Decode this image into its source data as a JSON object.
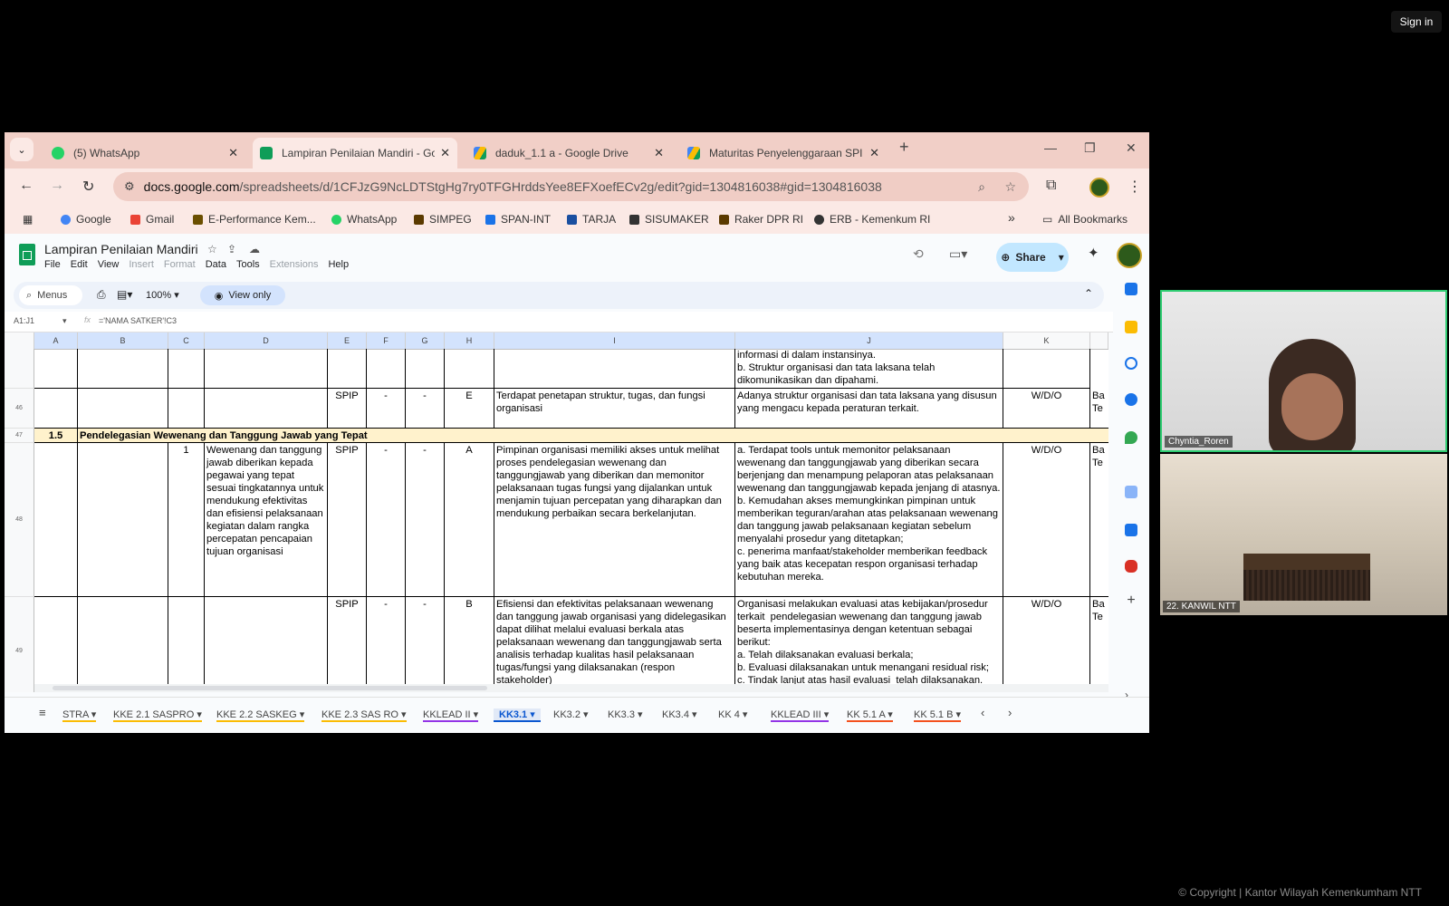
{
  "screen": {
    "signin_label": "Sign in",
    "copyright": "© Copyright | Kantor Wilayah Kemenkumham NTT"
  },
  "browser": {
    "tabs": [
      {
        "label": "(5) WhatsApp",
        "icon": "whatsapp-icon",
        "color": "#25d366"
      },
      {
        "label": "Lampiran Penilaian Mandiri - Go",
        "icon": "sheets-icon",
        "color": "#0f9d58"
      },
      {
        "label": "daduk_1.1 a - Google Drive",
        "icon": "drive-icon",
        "color": "#fbbc04"
      },
      {
        "label": "Maturitas Penyelenggaraan SPI",
        "icon": "drive-icon",
        "color": "#fbbc04"
      }
    ],
    "url_host": "docs.google.com",
    "url_path": "/spreadsheets/d/1CFJzG9NcLDTStgHg7ry0TFGHrddsYee8EFXoefECv2g/edit?gid=1304816038#gid=1304816038",
    "bookmarks": [
      {
        "label": "Google",
        "color": "#4285f4"
      },
      {
        "label": "Gmail",
        "color": "#ea4335"
      },
      {
        "label": "E-Performance Kem...",
        "color": "#6b4f00"
      },
      {
        "label": "WhatsApp",
        "color": "#25d366"
      },
      {
        "label": "SIMPEG",
        "color": "#5b3a00"
      },
      {
        "label": "SPAN-INT",
        "color": "#1a73e8"
      },
      {
        "label": "TARJA",
        "color": "#1a4fa0"
      },
      {
        "label": "SISUMAKER",
        "color": "#333333"
      },
      {
        "label": "Raker DPR RI",
        "color": "#5b3a00"
      },
      {
        "label": "ERB - Kemenkum RI",
        "color": "#333333"
      }
    ],
    "all_bookmarks": "All Bookmarks",
    "overflow": "»"
  },
  "sheets": {
    "doc_title": "Lampiran Penilaian Mandiri",
    "menus": [
      {
        "label": "File",
        "dim": false
      },
      {
        "label": "Edit",
        "dim": false
      },
      {
        "label": "View",
        "dim": false
      },
      {
        "label": "Insert",
        "dim": true
      },
      {
        "label": "Format",
        "dim": true
      },
      {
        "label": "Data",
        "dim": false
      },
      {
        "label": "Tools",
        "dim": false
      },
      {
        "label": "Extensions",
        "dim": true
      },
      {
        "label": "Help",
        "dim": false
      }
    ],
    "share_label": "Share",
    "menus_search": "Menus",
    "zoom": "100%",
    "view_only": "View only",
    "name_box": "A1:J1",
    "formula": "='NAMA SATKER'!C3",
    "columns": [
      "A",
      "B",
      "C",
      "D",
      "E",
      "F",
      "G",
      "H",
      "I",
      "J",
      "K"
    ],
    "row_numbers": [
      "46",
      "47",
      "48",
      "49"
    ],
    "top_partial": {
      "j": "informasi di dalam instansinya.\nb. Struktur organisasi dan tata laksana telah dikomunikasikan dan dipahami."
    },
    "row46": {
      "e": "SPIP",
      "f": "-",
      "g": "-",
      "h": "E",
      "i": "Terdapat penetapan struktur, tugas, dan fungsi organisasi",
      "j": "Adanya struktur organisasi dan tata laksana yang disusun yang mengacu kepada peraturan terkait.",
      "k": "W/D/O",
      "l": "Ba\nTe"
    },
    "row47": {
      "a": "1.5",
      "b": "Pendelegasian Wewenang dan Tanggung Jawab yang Tepat"
    },
    "row48": {
      "c": "1",
      "d": "Wewenang dan tanggung jawab diberikan kepada pegawai yang tepat sesuai tingkatannya untuk mendukung efektivitas dan efisiensi pelaksanaan kegiatan dalam rangka percepatan pencapaian tujuan organisasi",
      "e": "SPIP",
      "f": "-",
      "g": "-",
      "h": "A",
      "i": "Pimpinan organisasi memiliki akses untuk melihat proses pendelegasian wewenang dan tanggungjawab yang diberikan dan memonitor pelaksanaan tugas fungsi yang dijalankan untuk menjamin tujuan percepatan yang diharapkan dan mendukung perbaikan secara berkelanjutan.",
      "j": "a. Terdapat tools untuk memonitor pelaksanaan wewenang dan tanggungjawab yang diberikan secara berjenjang dan menampung pelaporan atas pelaksanaan wewenang dan tanggungjawab kepada jenjang di atasnya.\nb. Kemudahan akses memungkinkan pimpinan untuk memberikan teguran/arahan atas pelaksanaan wewenang dan tanggung jawab pelaksanaan kegiatan sebelum menyalahi prosedur yang ditetapkan;\nc. penerima manfaat/stakeholder memberikan feedback yang baik atas kecepatan respon organisasi terhadap kebutuhan mereka.",
      "k": "W/D/O",
      "l": "Ba\nTe"
    },
    "row49": {
      "e": "SPIP",
      "f": "-",
      "g": "-",
      "h": "B",
      "i": "Efisiensi dan efektivitas pelaksanaan wewenang dan tanggung jawab organisasi yang didelegasikan dapat dilihat melalui evaluasi berkala atas pelaksanaan wewenang dan tanggungjawab serta analisis terhadap kualitas hasil pelaksanaan tugas/fungsi yang dilaksanakan (respon stakeholder)",
      "j": "Organisasi melakukan evaluasi atas kebijakan/prosedur terkait  pendelegasian wewenang dan tanggung jawab beserta implementasinya dengan ketentuan sebagai berikut:\na. Telah dilaksanakan evaluasi berkala;\nb. Evaluasi dilaksanakan untuk menangani residual risk;\nc. Tindak lanjut atas hasil evaluasi  telah dilaksanakan.",
      "k": "W/D/O",
      "l": "Ba\nTe"
    },
    "sheet_tabs": [
      {
        "label": "STRA",
        "active": false,
        "color": "#fbbc04"
      },
      {
        "label": "KKE 2.1 SASPRO",
        "active": false,
        "color": "#fbbc04"
      },
      {
        "label": "KKE 2.2 SASKEG",
        "active": false,
        "color": "#fbbc04"
      },
      {
        "label": "KKE 2.3 SAS RO",
        "active": false,
        "color": "#fbbc04"
      },
      {
        "label": "KKLEAD II",
        "active": false,
        "color": "#9334e6"
      },
      {
        "label": "KK3.1",
        "active": true,
        "color": "#0b57d0"
      },
      {
        "label": "KK3.2",
        "active": false,
        "color": ""
      },
      {
        "label": "KK3.3",
        "active": false,
        "color": ""
      },
      {
        "label": "KK3.4",
        "active": false,
        "color": ""
      },
      {
        "label": "KK 4",
        "active": false,
        "color": ""
      },
      {
        "label": "KKLEAD III",
        "active": false,
        "color": "#9334e6"
      },
      {
        "label": "KK 5.1 A",
        "active": false,
        "color": "#f4511e"
      },
      {
        "label": "KK 5.1 B",
        "active": false,
        "color": "#f4511e"
      }
    ]
  },
  "video": {
    "participants": [
      {
        "name": "Chyntia_Roren"
      },
      {
        "name": "22. KANWIL NTT"
      }
    ]
  }
}
